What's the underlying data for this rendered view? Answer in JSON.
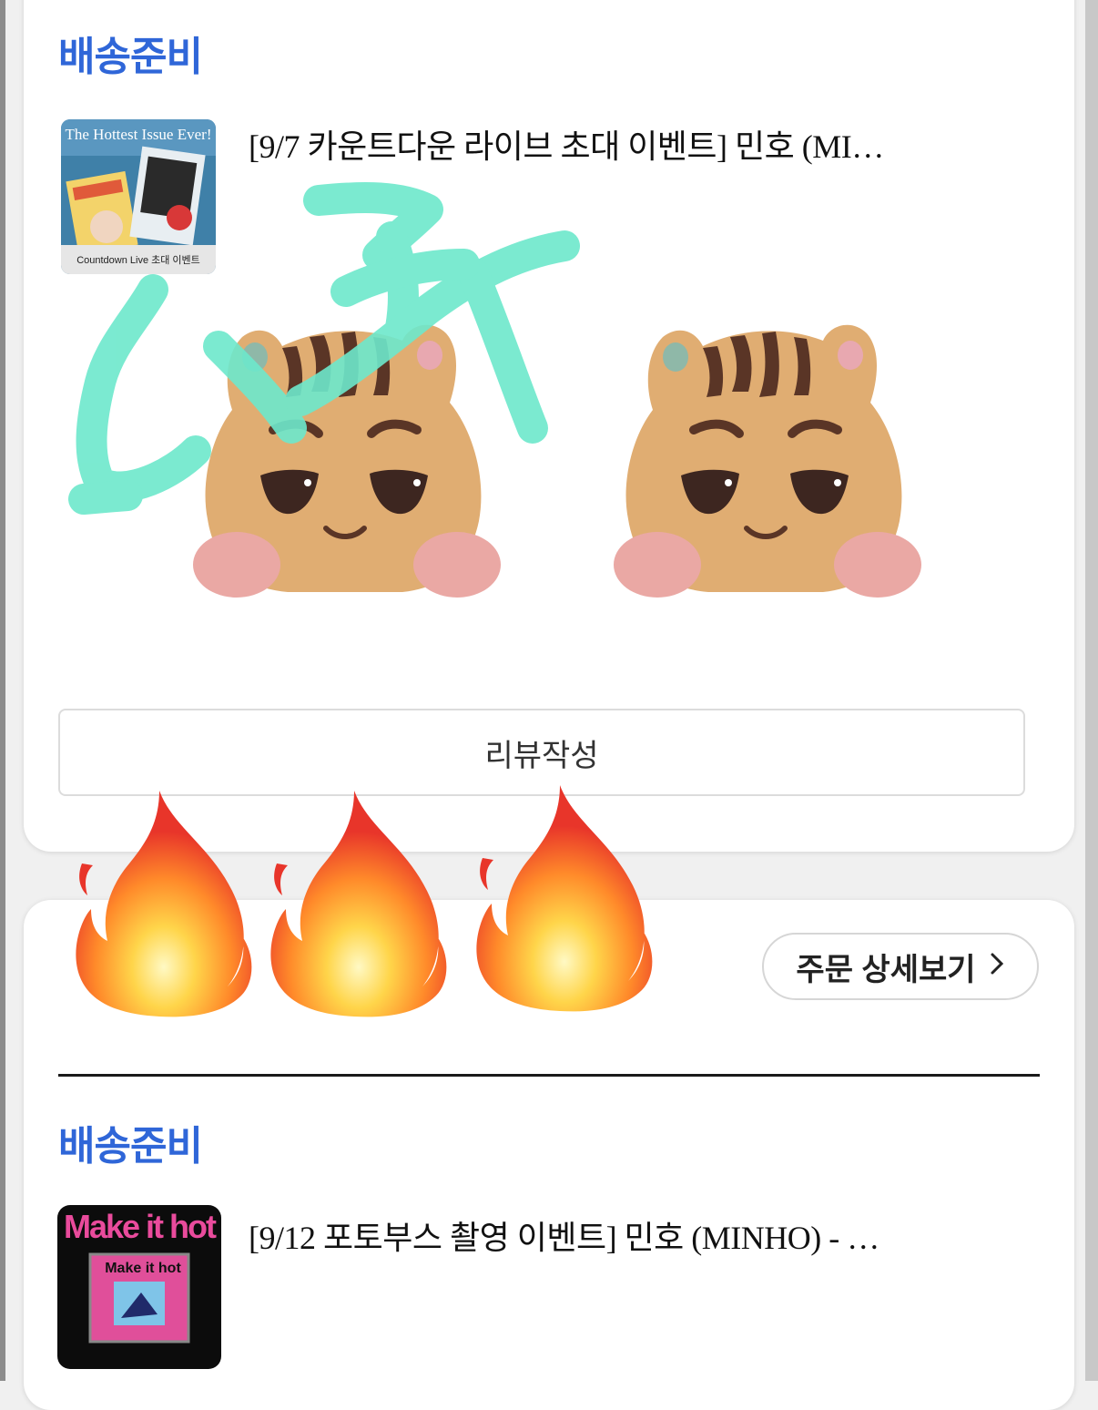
{
  "orders": [
    {
      "status": "배송준비",
      "product_title": "[9/7 카운트다운 라이브 초대 이벤트] 민호 (MI…",
      "thumbnail": {
        "headline": "The Hottest Issue Ever!",
        "caption": "Countdown Live 초대 이벤트"
      },
      "review_button": "리뷰작성"
    },
    {
      "detail_button": "주문 상세보기",
      "status": "배송준비",
      "product_title": "[9/12 포토부스 촬영 이벤트] 민호 (MINHO) - …",
      "thumbnail": {
        "headline": "Make it hot",
        "sub_headline": "Make it hot"
      }
    }
  ],
  "colors": {
    "status_blue": "#2f66d8",
    "marker_mint": "#6de8cc",
    "plush_fur": "#e0ad72"
  },
  "stickers": [
    "plush-hamster-sticker",
    "plush-hamster-sticker",
    "fire-emoji",
    "fire-emoji",
    "fire-emoji"
  ]
}
